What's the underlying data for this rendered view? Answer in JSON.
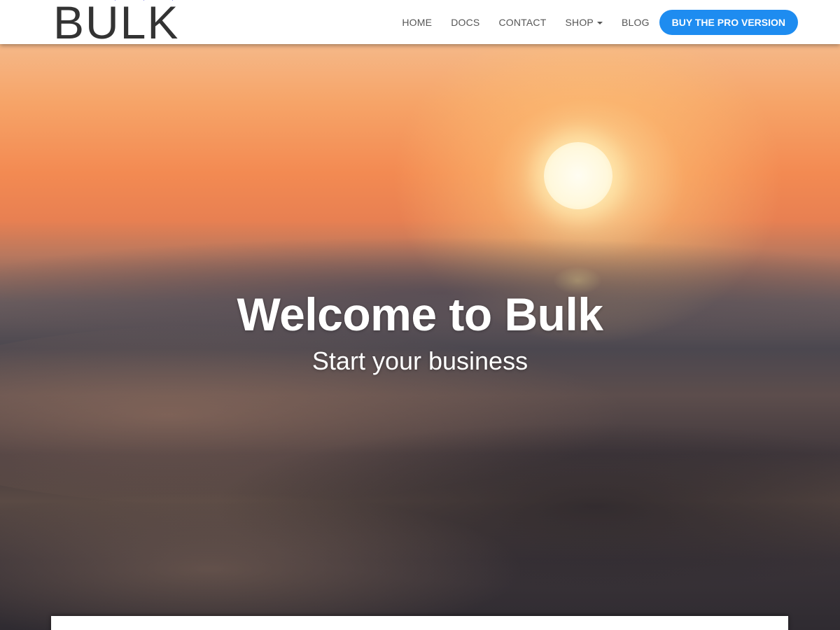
{
  "brand": {
    "logo_text": "BULK"
  },
  "nav": {
    "items": [
      {
        "label": "HOME"
      },
      {
        "label": "DOCS"
      },
      {
        "label": "CONTACT"
      },
      {
        "label": "SHOP",
        "has_dropdown": true
      },
      {
        "label": "BLOG"
      }
    ],
    "cta_label": "BUY THE PRO VERSION"
  },
  "hero": {
    "title": "Welcome to Bulk",
    "subtitle": "Start your business"
  },
  "colors": {
    "accent": "#1e8cf0",
    "nav_text": "#555555",
    "logo_text": "#333333",
    "hero_text": "#ffffff"
  }
}
